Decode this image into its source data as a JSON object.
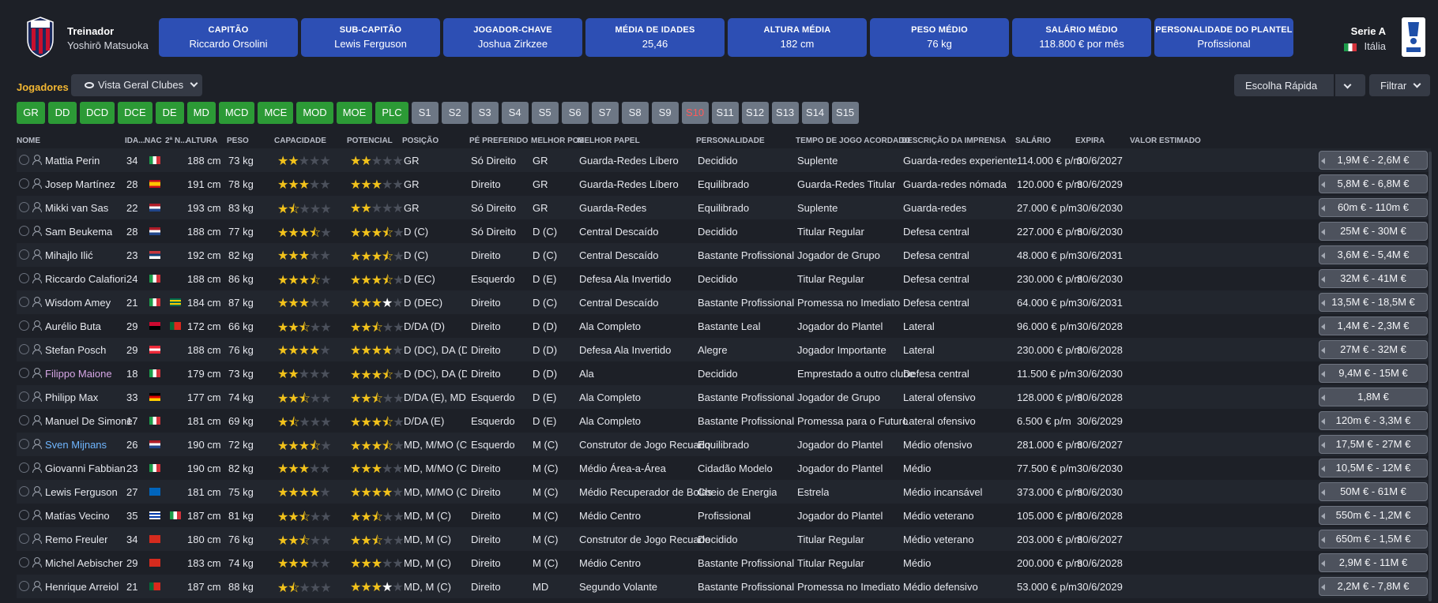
{
  "header": {
    "manager_label": "Treinador",
    "manager_name": "Yoshirō Matsuoka",
    "cards": [
      {
        "label": "CAPITÃO",
        "value": "Riccardo Orsolini"
      },
      {
        "label": "SUB-CAPITÃO",
        "value": "Lewis Ferguson"
      },
      {
        "label": "JOGADOR-CHAVE",
        "value": "Joshua Zirkzee"
      },
      {
        "label": "MÉDIA DE IDADES",
        "value": "25,46"
      },
      {
        "label": "ALTURA MÉDIA",
        "value": "182 cm"
      },
      {
        "label": "PESO MÉDIO",
        "value": "76 kg"
      },
      {
        "label": "SALÁRIO MÉDIO",
        "value": "118.800 € por mês"
      },
      {
        "label": "PERSONALIDADE DO PLANTEL",
        "value": "Profissional"
      }
    ],
    "league_name": "Serie A",
    "league_country": "Itália"
  },
  "toolbar": {
    "players_label": "Jogadores",
    "view_label": "Vista Geral Clubes",
    "quick_pick_label": "Escolha Rápida",
    "filter_label": "Filtrar"
  },
  "position_chips": [
    "GR",
    "DD",
    "DCD",
    "DCE",
    "DE",
    "MD",
    "MCD",
    "MCE",
    "MOD",
    "MOE",
    "PLC"
  ],
  "squad_chips": [
    "S1",
    "S2",
    "S3",
    "S4",
    "S5",
    "S6",
    "S7",
    "S8",
    "S9",
    "S10",
    "S11",
    "S12",
    "S13",
    "S14",
    "S15"
  ],
  "columns": [
    "NOME",
    "IDA...",
    "NAC",
    "2ª N...",
    "ALTURA",
    "PESO",
    "CAPACIDADE",
    "POTENCIAL",
    "POSIÇÃO",
    "PÉ PREFERIDO",
    "MELHOR POS",
    "MELHOR PAPEL",
    "PERSONALIDADE",
    "TEMPO DE JOGO ACORDADO",
    "DESCRIÇÃO DA IMPRENSA",
    "SALÁRIO",
    "EXPIRA",
    "VALOR ESTIMADO"
  ],
  "players": [
    {
      "name": "Mattia Perin",
      "age": "34",
      "nat": "it",
      "nat2": "",
      "height": "188 cm",
      "weight": "73 kg",
      "ability": 2,
      "potential": 2,
      "pot_white": 0,
      "position": "GR",
      "foot": "Só Direito",
      "best_pos": "GR",
      "role": "Guarda-Redes Líbero",
      "personality": "Decidido",
      "playtime": "Suplente",
      "press": "Guarda-redes experiente",
      "wage": "114.000 € p/m",
      "expires": "30/6/2027",
      "value": "1,9M € - 2,6M €"
    },
    {
      "name": "Josep Martínez",
      "age": "28",
      "nat": "es",
      "nat2": "",
      "height": "191 cm",
      "weight": "78 kg",
      "ability": 3,
      "potential": 3,
      "pot_white": 0,
      "position": "GR",
      "foot": "Direito",
      "best_pos": "GR",
      "role": "Guarda-Redes Líbero",
      "personality": "Equilibrado",
      "playtime": "Guarda-Redes Titular",
      "press": "Guarda-redes nómada",
      "wage": "120.000 € p/m",
      "expires": "30/6/2029",
      "value": "5,8M € - 6,8M €"
    },
    {
      "name": "Mikki van Sas",
      "age": "22",
      "nat": "nl",
      "nat2": "",
      "height": "193 cm",
      "weight": "83 kg",
      "ability": 1.5,
      "potential": 2,
      "pot_white": 0,
      "position": "GR",
      "foot": "Só Direito",
      "best_pos": "GR",
      "role": "Guarda-Redes",
      "personality": "Equilibrado",
      "playtime": "Suplente",
      "press": "Guarda-redes",
      "wage": "27.000 € p/m",
      "expires": "30/6/2030",
      "value": "60m € - 110m €"
    },
    {
      "name": "Sam Beukema",
      "age": "28",
      "nat": "nl",
      "nat2": "",
      "height": "188 cm",
      "weight": "77 kg",
      "ability": 3.5,
      "potential": 3.5,
      "pot_white": 0,
      "position": "D (C)",
      "foot": "Só Direito",
      "best_pos": "D (C)",
      "role": "Central Descaído",
      "personality": "Decidido",
      "playtime": "Titular Regular",
      "press": "Defesa central",
      "wage": "227.000 € p/m",
      "expires": "30/6/2030",
      "value": "25M € - 30M €"
    },
    {
      "name": "Mihajlo Ilić",
      "age": "23",
      "nat": "rs",
      "nat2": "",
      "height": "192 cm",
      "weight": "82 kg",
      "ability": 3,
      "potential": 3.5,
      "pot_white": 0,
      "position": "D (C)",
      "foot": "Direito",
      "best_pos": "D (C)",
      "role": "Central Descaído",
      "personality": "Bastante Profissional",
      "playtime": "Jogador de Grupo",
      "press": "Defesa central",
      "wage": "48.000 € p/m",
      "expires": "30/6/2031",
      "value": "3,6M € - 5,4M €"
    },
    {
      "name": "Riccardo Calafiori",
      "age": "24",
      "nat": "it",
      "nat2": "",
      "height": "188 cm",
      "weight": "86 kg",
      "ability": 3.5,
      "potential": 3.5,
      "pot_white": 0,
      "position": "D (EC)",
      "foot": "Esquerdo",
      "best_pos": "D (E)",
      "role": "Defesa Ala Invertido",
      "personality": "Decidido",
      "playtime": "Titular Regular",
      "press": "Defesa central",
      "wage": "230.000 € p/m",
      "expires": "30/6/2030",
      "value": "32M € - 41M €"
    },
    {
      "name": "Wisdom Amey",
      "age": "21",
      "nat": "it",
      "nat2": "tg",
      "height": "184 cm",
      "weight": "87 kg",
      "ability": 3,
      "potential": 3,
      "pot_white": 1,
      "position": "D (DEC)",
      "foot": "Direito",
      "best_pos": "D (C)",
      "role": "Central Descaído",
      "personality": "Bastante Profissional",
      "playtime": "Promessa no Imediato",
      "press": "Defesa central",
      "wage": "64.000 € p/m",
      "expires": "30/6/2031",
      "value": "13,5M € - 18,5M €"
    },
    {
      "name": "Aurélio Buta",
      "age": "29",
      "nat": "ao",
      "nat2": "pt",
      "height": "172 cm",
      "weight": "66 kg",
      "ability": 2.5,
      "potential": 2.5,
      "pot_white": 0,
      "position": "D/DA (D)",
      "foot": "Direito",
      "best_pos": "D (D)",
      "role": "Ala Completo",
      "personality": "Bastante Leal",
      "playtime": "Jogador do Plantel",
      "press": "Lateral",
      "wage": "96.000 € p/m",
      "expires": "30/6/2028",
      "value": "1,4M € - 2,3M €"
    },
    {
      "name": "Stefan Posch",
      "age": "29",
      "nat": "at",
      "nat2": "",
      "height": "188 cm",
      "weight": "76 kg",
      "ability": 4,
      "potential": 4,
      "pot_white": 0,
      "position": "D (DC), DA (D)",
      "foot": "Direito",
      "best_pos": "D (D)",
      "role": "Defesa Ala Invertido",
      "personality": "Alegre",
      "playtime": "Jogador Importante",
      "press": "Lateral",
      "wage": "230.000 € p/m",
      "expires": "30/6/2028",
      "value": "27M € - 32M €"
    },
    {
      "name": "Filippo Maione",
      "age": "18",
      "nat": "it",
      "nat2": "",
      "height": "179 cm",
      "weight": "73 kg",
      "ability": 2,
      "potential": 3.5,
      "pot_white": 0.5,
      "position": "D (DC), DA (D)",
      "foot": "Direito",
      "best_pos": "D (D)",
      "role": "Ala",
      "personality": "Decidido",
      "playtime": "Emprestado a outro clube",
      "press": "Defesa central",
      "wage": "11.500 € p/m",
      "expires": "30/6/2030",
      "value": "9,4M € - 15M €",
      "style": "loan"
    },
    {
      "name": "Philipp Max",
      "age": "33",
      "nat": "de",
      "nat2": "",
      "height": "177 cm",
      "weight": "74 kg",
      "ability": 2.5,
      "potential": 2.5,
      "pot_white": 0,
      "position": "D/DA (E), MD,...",
      "foot": "Esquerdo",
      "best_pos": "D (E)",
      "role": "Ala Completo",
      "personality": "Bastante Profissional",
      "playtime": "Jogador de Grupo",
      "press": "Lateral ofensivo",
      "wage": "128.000 € p/m",
      "expires": "30/6/2028",
      "value": "1,8M €"
    },
    {
      "name": "Manuel De Simone",
      "age": "17",
      "nat": "it",
      "nat2": "",
      "height": "181 cm",
      "weight": "69 kg",
      "ability": 1.5,
      "potential": 3.5,
      "pot_white": 0.5,
      "position": "D/DA (E)",
      "foot": "Esquerdo",
      "best_pos": "D (E)",
      "role": "Ala Completo",
      "personality": "Bastante Profissional",
      "playtime": "Promessa para o Futuro",
      "press": "Lateral ofensivo",
      "wage": "6.500 € p/m",
      "expires": "30/6/2029",
      "value": "120m € - 3,3M €"
    },
    {
      "name": "Sven Mijnans",
      "age": "26",
      "nat": "nl",
      "nat2": "",
      "height": "190 cm",
      "weight": "72 kg",
      "ability": 3.5,
      "potential": 3.5,
      "pot_white": 0,
      "position": "MD, M/MO (C)",
      "foot": "Esquerdo",
      "best_pos": "M (C)",
      "role": "Construtor de Jogo Recuado",
      "personality": "Equilibrado",
      "playtime": "Jogador do Plantel",
      "press": "Médio ofensivo",
      "wage": "281.000 € p/m",
      "expires": "30/6/2027",
      "value": "17,5M € - 27M €",
      "style": "blue"
    },
    {
      "name": "Giovanni Fabbian",
      "age": "23",
      "nat": "it",
      "nat2": "",
      "height": "190 cm",
      "weight": "82 kg",
      "ability": 3,
      "potential": 3,
      "pot_white": 0,
      "position": "MD, M/MO (C)",
      "foot": "Direito",
      "best_pos": "M (C)",
      "role": "Médio Área-a-Área",
      "personality": "Cidadão Modelo",
      "playtime": "Jogador do Plantel",
      "press": "Médio",
      "wage": "77.500 € p/m",
      "expires": "30/6/2030",
      "value": "10,5M € - 12M €"
    },
    {
      "name": "Lewis Ferguson",
      "age": "27",
      "nat": "sc",
      "nat2": "",
      "height": "181 cm",
      "weight": "75 kg",
      "ability": 4,
      "potential": 4,
      "pot_white": 0,
      "position": "MD, M/MO (C)",
      "foot": "Direito",
      "best_pos": "M (C)",
      "role": "Médio Recuperador de Bolas",
      "personality": "Cheio de Energia",
      "playtime": "Estrela",
      "press": "Médio incansável",
      "wage": "373.000 € p/m",
      "expires": "30/6/2030",
      "value": "50M € - 61M €"
    },
    {
      "name": "Matías Vecino",
      "age": "35",
      "nat": "uy",
      "nat2": "it",
      "height": "187 cm",
      "weight": "81 kg",
      "ability": 2.5,
      "potential": 2.5,
      "pot_white": 0,
      "position": "MD, M (C)",
      "foot": "Direito",
      "best_pos": "M (C)",
      "role": "Médio Centro",
      "personality": "Profissional",
      "playtime": "Jogador do Plantel",
      "press": "Médio veterano",
      "wage": "105.000 € p/m",
      "expires": "30/6/2028",
      "value": "550m € - 1,2M €"
    },
    {
      "name": "Remo Freuler",
      "age": "34",
      "nat": "ch",
      "nat2": "",
      "height": "180 cm",
      "weight": "76 kg",
      "ability": 2.5,
      "potential": 2.5,
      "pot_white": 0,
      "position": "MD, M (C)",
      "foot": "Direito",
      "best_pos": "M (C)",
      "role": "Construtor de Jogo Recuado",
      "personality": "Decidido",
      "playtime": "Titular Regular",
      "press": "Médio veterano",
      "wage": "203.000 € p/m",
      "expires": "30/6/2027",
      "value": "650m € - 1,5M €"
    },
    {
      "name": "Michel Aebischer",
      "age": "29",
      "nat": "ch",
      "nat2": "",
      "height": "183 cm",
      "weight": "74 kg",
      "ability": 3,
      "potential": 3,
      "pot_white": 0,
      "position": "MD, M (C)",
      "foot": "Direito",
      "best_pos": "M (C)",
      "role": "Médio Centro",
      "personality": "Bastante Profissional",
      "playtime": "Titular Regular",
      "press": "Médio",
      "wage": "200.000 € p/m",
      "expires": "30/6/2028",
      "value": "2,9M € - 11M €"
    },
    {
      "name": "Henrique Arreiol",
      "age": "21",
      "nat": "pt",
      "nat2": "",
      "height": "187 cm",
      "weight": "88 kg",
      "ability": 1.5,
      "potential": 3,
      "pot_white": 1,
      "position": "MD, M (C)",
      "foot": "Direito",
      "best_pos": "MD",
      "role": "Segundo Volante",
      "personality": "Bastante Profissional",
      "playtime": "Promessa no Imediato",
      "press": "Médio defensivo",
      "wage": "53.000 € p/m",
      "expires": "30/6/2029",
      "value": "2,2M € - 7,8M €"
    }
  ],
  "colors": {
    "card_blue": "#2d4fb4",
    "chip_green": "#2c9a36",
    "chip_grey": "#6d7785",
    "accent_orange": "#f2b632",
    "star": "#f2c21b"
  }
}
